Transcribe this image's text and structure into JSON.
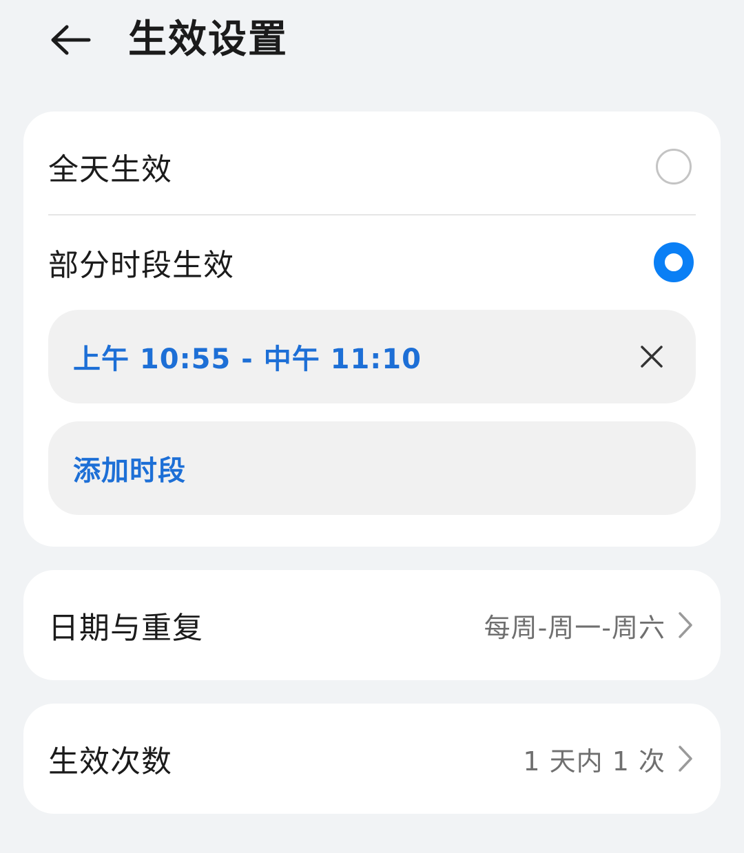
{
  "header": {
    "title": "生效设置",
    "back_icon": "arrow-left-icon"
  },
  "time_settings": {
    "all_day": {
      "label": "全天生效",
      "selected": false
    },
    "partial": {
      "label": "部分时段生效",
      "selected": true
    },
    "time_ranges": [
      {
        "label": "上午 10:55 - 中午 11:10"
      }
    ],
    "add_range_label": "添加时段"
  },
  "date_repeat": {
    "label": "日期与重复",
    "value": "每周-周一-周六"
  },
  "effect_count": {
    "label": "生效次数",
    "value": "1 天内 1 次"
  },
  "colors": {
    "accent": "#0a7ff5",
    "link_text": "#1d6fd6",
    "background": "#f1f3f5",
    "card": "#ffffff",
    "pill": "#f1f1f1",
    "secondary_text": "#6f6f6f"
  }
}
